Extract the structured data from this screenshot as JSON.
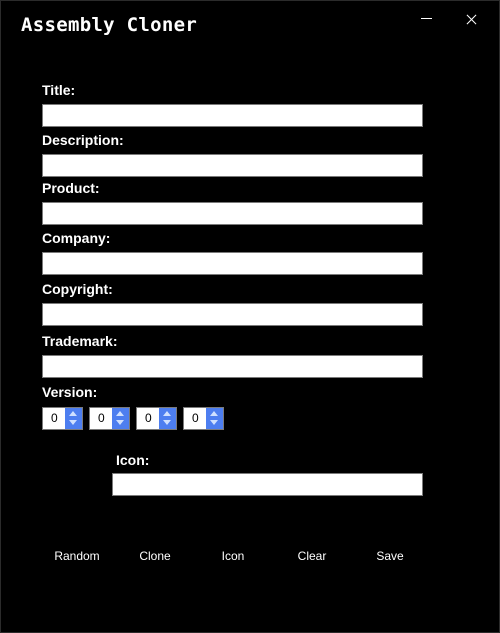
{
  "window": {
    "title": "Assembly Cloner"
  },
  "fields": {
    "title_label": "Title:",
    "description_label": "Description:",
    "product_label": "Product:",
    "company_label": "Company:",
    "copyright_label": "Copyright:",
    "trademark_label": "Trademark:",
    "version_label": "Version:",
    "icon_label": "Icon:",
    "title_value": "",
    "description_value": "",
    "product_value": "",
    "company_value": "",
    "copyright_value": "",
    "trademark_value": "",
    "icon_value": ""
  },
  "version": {
    "major": "0",
    "minor": "0",
    "build": "0",
    "revision": "0"
  },
  "buttons": {
    "random": "Random",
    "clone": "Clone",
    "icon": "Icon",
    "clear": "Clear",
    "save": "Save"
  },
  "colors": {
    "background": "#000000",
    "spinner_accent": "#4d7ef0",
    "text": "#ffffff"
  }
}
